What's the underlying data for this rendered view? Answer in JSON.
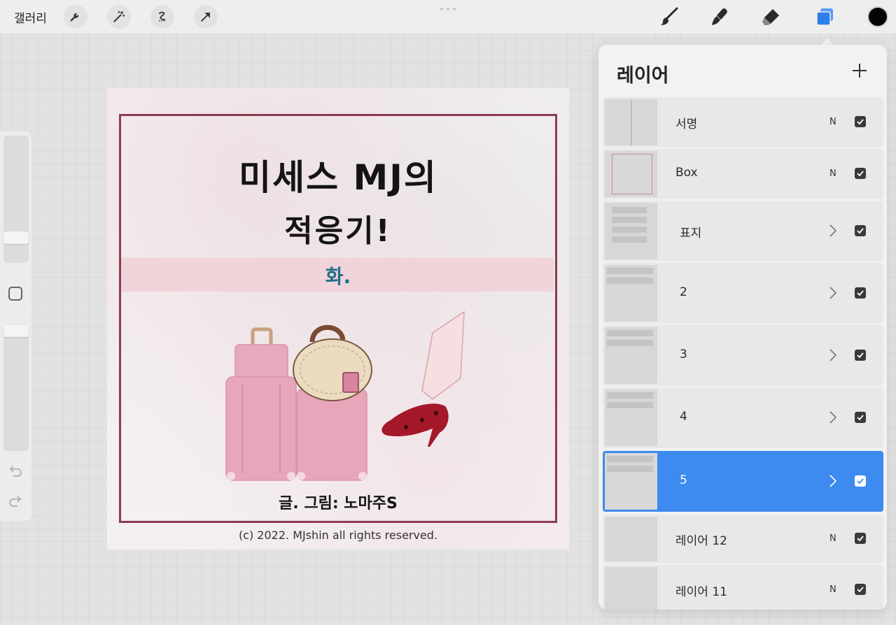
{
  "topbar": {
    "gallery_label": "갤러리",
    "left_tools": [
      "wrench-icon",
      "magic-wand-icon",
      "selection-icon",
      "transform-arrow-icon"
    ],
    "right_tools": [
      "brush-icon",
      "smudge-icon",
      "eraser-icon",
      "layers-icon"
    ],
    "current_color": "#050505",
    "accent": "#3d8af0"
  },
  "canvas": {
    "title_line1": "미세스 MJ의",
    "title_line2": "적응기!",
    "episode": "화.",
    "author": "글. 그림: 노마주S",
    "copyright": "(c) 2022. MJshin all rights reserved.",
    "frame_color": "#8d3a52",
    "band_color": "#f1d3da"
  },
  "layers_panel": {
    "title": "레이어",
    "layers": [
      {
        "name": "서명",
        "blend": "N",
        "type": "layer",
        "visible": true,
        "selected": false
      },
      {
        "name": "Box",
        "blend": "N",
        "type": "layer",
        "visible": true,
        "selected": false
      },
      {
        "name": "표지",
        "blend": "",
        "type": "group",
        "visible": true,
        "selected": false
      },
      {
        "name": "2",
        "blend": "",
        "type": "group",
        "visible": true,
        "selected": false
      },
      {
        "name": "3",
        "blend": "",
        "type": "group",
        "visible": true,
        "selected": false
      },
      {
        "name": "4",
        "blend": "",
        "type": "group",
        "visible": true,
        "selected": false
      },
      {
        "name": "5",
        "blend": "",
        "type": "group",
        "visible": true,
        "selected": true
      },
      {
        "name": "레이어 12",
        "blend": "N",
        "type": "layer",
        "visible": true,
        "selected": false
      },
      {
        "name": "레이어 11",
        "blend": "N",
        "type": "layer",
        "visible": true,
        "selected": false
      }
    ]
  }
}
